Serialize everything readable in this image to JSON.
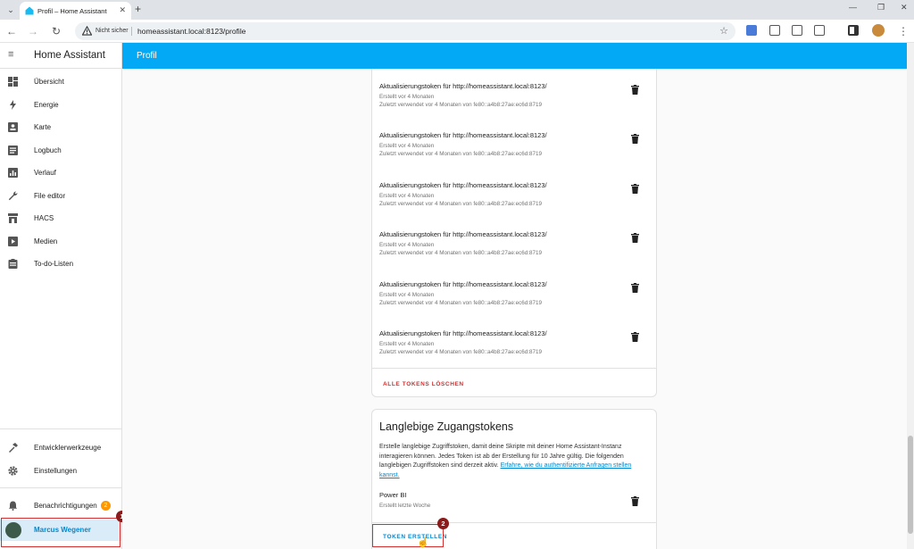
{
  "browser": {
    "tab_title": "Profil – Home Assistant",
    "not_secure": "Nicht sicher",
    "url": "homeassistant.local:8123/profile"
  },
  "app": {
    "title": "Home Assistant",
    "page_title": "Profil"
  },
  "sidebar": {
    "items": [
      {
        "label": "Übersicht",
        "icon": "dashboard-icon"
      },
      {
        "label": "Energie",
        "icon": "lightning-icon"
      },
      {
        "label": "Karte",
        "icon": "map-icon"
      },
      {
        "label": "Logbuch",
        "icon": "logbook-icon"
      },
      {
        "label": "Verlauf",
        "icon": "chart-icon"
      },
      {
        "label": "File editor",
        "icon": "wrench-icon"
      },
      {
        "label": "HACS",
        "icon": "store-icon"
      },
      {
        "label": "Medien",
        "icon": "media-icon"
      },
      {
        "label": "To-do-Listen",
        "icon": "clipboard-icon"
      }
    ],
    "dev_tools": "Entwicklerwerkzeuge",
    "settings": "Einstellungen",
    "notifications": "Benachrichtigungen",
    "notifications_count": "2",
    "user": "Marcus Wegener"
  },
  "refresh_tokens": {
    "items": [
      {
        "name": "Aktualisierungstoken für http://homeassistant.local:8123/",
        "created": "Erstellt vor 4 Monaten",
        "used": "Zuletzt verwendet vor 4 Monaten von fe80::a4b8:27ae:ec6d:8719"
      },
      {
        "name": "Aktualisierungstoken für http://homeassistant.local:8123/",
        "created": "Erstellt vor 4 Monaten",
        "used": "Zuletzt verwendet vor 4 Monaten von fe80::a4b8:27ae:ec6d:8719"
      },
      {
        "name": "Aktualisierungstoken für http://homeassistant.local:8123/",
        "created": "Erstellt vor 4 Monaten",
        "used": "Zuletzt verwendet vor 4 Monaten von fe80::a4b8:27ae:ec6d:8719"
      },
      {
        "name": "Aktualisierungstoken für http://homeassistant.local:8123/",
        "created": "Erstellt vor 4 Monaten",
        "used": "Zuletzt verwendet vor 4 Monaten von fe80::a4b8:27ae:ec6d:8719"
      },
      {
        "name": "Aktualisierungstoken für http://homeassistant.local:8123/",
        "created": "Erstellt vor 4 Monaten",
        "used": "Zuletzt verwendet vor 4 Monaten von fe80::a4b8:27ae:ec6d:8719"
      },
      {
        "name": "Aktualisierungstoken für http://homeassistant.local:8123/",
        "created": "Erstellt vor 4 Monaten",
        "used": "Zuletzt verwendet vor 4 Monaten von fe80::a4b8:27ae:ec6d:8719"
      }
    ],
    "delete_all": "ALLE TOKENS LÖSCHEN"
  },
  "long_lived": {
    "title": "Langlebige Zugangstokens",
    "description": "Erstelle langlebige Zugriffstoken, damit deine Skripte mit deiner Home Assistant-Instanz interagieren können. Jedes Token ist ab der Erstellung für 10 Jahre gültig. Die folgenden langlebigen Zugriffstoken sind derzeit aktiv.",
    "link": "Erfahre, wie du authentifizierte Anfragen stellen kannst.",
    "token_name": "Power BI",
    "token_created": "Erstellt letzte Woche",
    "create_button": "TOKEN ERSTELLEN"
  },
  "markers": {
    "one": "1",
    "two": "2"
  },
  "colors": {
    "accent": "#03a9f4",
    "link": "#0288d1",
    "danger": "#d32f2f",
    "highlight": "#d32f2f"
  }
}
